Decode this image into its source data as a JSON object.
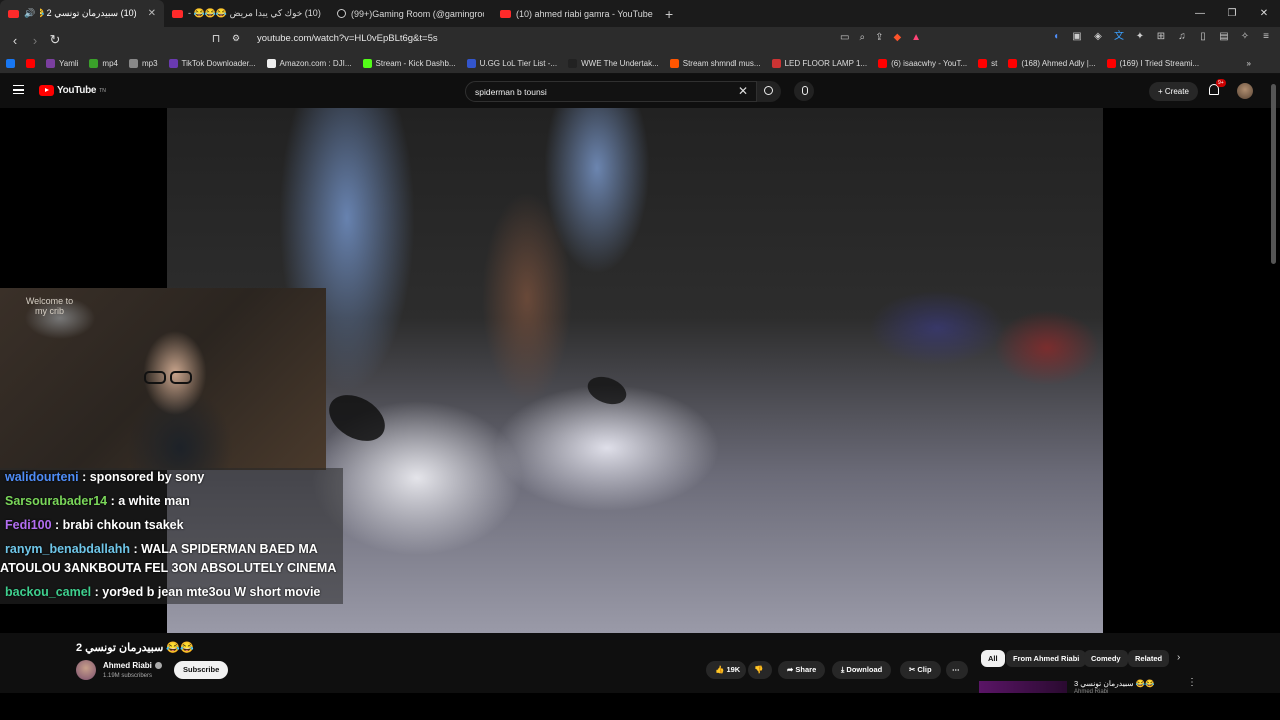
{
  "tabs": [
    {
      "title": "(10) سبيدرمان تونسي 2 😂😂",
      "active": true
    },
    {
      "title": "(10) خوك كي يبدا مريض 😂😂😂 -",
      "active": false
    },
    {
      "title": "(99+)Gaming Room (@gamingroom",
      "active": false
    },
    {
      "title": "(10) ahmed riabi gamra - YouTube",
      "active": false
    }
  ],
  "window_controls": {
    "minimize": "—",
    "maximize": "❐",
    "close": "✕"
  },
  "address_bar": {
    "url": "youtube.com/watch?v=HL0vEpBLt6g&t=5s"
  },
  "bookmarks": [
    {
      "label": "",
      "color": "#1877f2"
    },
    {
      "label": "",
      "color": "#ff0000"
    },
    {
      "label": "Yamli",
      "color": "#7b3fa0"
    },
    {
      "label": "mp4",
      "color": "#3aa02a"
    },
    {
      "label": "mp3",
      "color": "#888888"
    },
    {
      "label": "TikTok Downloader...",
      "color": "#6a3ab0"
    },
    {
      "label": "Amazon.com : DJI...",
      "color": "#eeeeee"
    },
    {
      "label": "Stream - Kick Dashb...",
      "color": "#53fc18"
    },
    {
      "label": "U.GG LoL Tier List -...",
      "color": "#3355cc"
    },
    {
      "label": "WWE The Undertak...",
      "color": "#222222"
    },
    {
      "label": "Stream shmndl mus...",
      "color": "#ff5500"
    },
    {
      "label": "LED FLOOR LAMP 1...",
      "color": "#cc3333"
    },
    {
      "label": "(6) isaacwhy - YouT...",
      "color": "#ff0000"
    },
    {
      "label": "st",
      "color": "#ff0000"
    },
    {
      "label": "(168) Ahmed Adly |...",
      "color": "#ff0000"
    },
    {
      "label": "(169) I Tried Streami...",
      "color": "#ff0000"
    }
  ],
  "youtube": {
    "logo_text": "YouTube",
    "logo_region": "TN",
    "search_query": "spiderman b tounsi",
    "create_label": "Create",
    "notification_badge": "9+"
  },
  "webcam": {
    "sign_text": "Welcome to my crib"
  },
  "chat": [
    {
      "user": "walidourteni",
      "text": " : sponsored by sony",
      "color": "#4f8df7"
    },
    {
      "user": "Sarsourabader14",
      "text": " : a white man",
      "color": "#7ad65a"
    },
    {
      "user": "Fedi100",
      "text": " : brabi chkoun tsakek",
      "color": "#b36ef2"
    },
    {
      "user": "ranym_benabdallahh",
      "text": " : WALA SPIDERMAN BAED MA",
      "color": "#6fc6e8"
    },
    {
      "user": "",
      "text": "ATOULOU 3ANKBOUTA FEL 3ON ABSOLUTELY CINEMA",
      "color": "#ffffff"
    },
    {
      "user": "backou_camel",
      "text": " : yor9ed b jean mte3ou W short movie",
      "color": "#3fcf8e"
    }
  ],
  "video": {
    "title": "سبيدرمان تونسي 2 😂😂",
    "channel": "Ahmed Riabi",
    "subscribers": "1.19M subscribers",
    "subscribe_label": "Subscribe",
    "likes": "19K",
    "share_label": "Share",
    "download_label": "Download",
    "clip_label": "Clip",
    "more_label": "⋯"
  },
  "chips": [
    "All",
    "From Ahmed Riabi",
    "Comedy",
    "Related"
  ],
  "related": {
    "title": "سبيدرمان تونسي 3 😂😂",
    "channel": "Ahmed Riabi"
  }
}
